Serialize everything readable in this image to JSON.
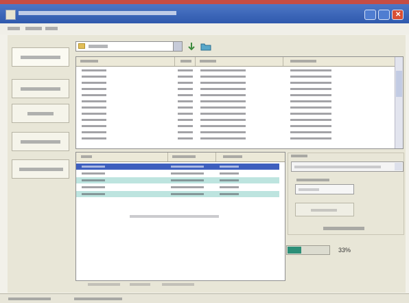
{
  "window": {
    "title": "",
    "controls": [
      "minimize-icon",
      "maximize-icon",
      "close-icon"
    ]
  },
  "menu": {
    "items": [
      "",
      "",
      ""
    ]
  },
  "sidebar": {
    "items": [
      "",
      "",
      "",
      "",
      ""
    ]
  },
  "folder": {
    "value": "",
    "icons": [
      "arrow-icon",
      "folder-icon"
    ]
  },
  "file_list": {
    "columns": [
      "",
      "",
      "",
      ""
    ],
    "rows": [
      [
        "",
        "",
        "",
        ""
      ],
      [
        "",
        "",
        "",
        ""
      ],
      [
        "",
        "",
        "",
        ""
      ],
      [
        "",
        "",
        "",
        ""
      ],
      [
        "",
        "",
        "",
        ""
      ],
      [
        "",
        "",
        "",
        ""
      ],
      [
        "",
        "",
        "",
        ""
      ],
      [
        "",
        "",
        "",
        ""
      ],
      [
        "",
        "",
        "",
        ""
      ],
      [
        "",
        "",
        "",
        ""
      ],
      [
        "",
        "",
        "",
        ""
      ],
      [
        "",
        "",
        "",
        ""
      ]
    ]
  },
  "queue": {
    "columns": [
      "",
      "",
      ""
    ],
    "rows": [
      [
        "",
        "",
        ""
      ],
      [
        "",
        "",
        ""
      ],
      [
        "",
        "",
        ""
      ],
      [
        "",
        "",
        ""
      ],
      [
        "",
        "",
        ""
      ]
    ],
    "drop_hint": "",
    "footer": [
      "",
      "",
      ""
    ]
  },
  "right_panel": {
    "group_label": "",
    "format_value": "",
    "quality_label": "",
    "quality_value": "",
    "start_button": "",
    "status_label": "",
    "progress": {
      "value": 0.33,
      "label": "33%",
      "color": "#2c8f78"
    }
  },
  "statusbar": {
    "items": [
      "",
      ""
    ]
  },
  "colors": {
    "title_start": "#4d77c6",
    "title_end": "#2f59ad",
    "selected_row": "#3e5fbe",
    "highlight_rows": "#bde4df"
  }
}
